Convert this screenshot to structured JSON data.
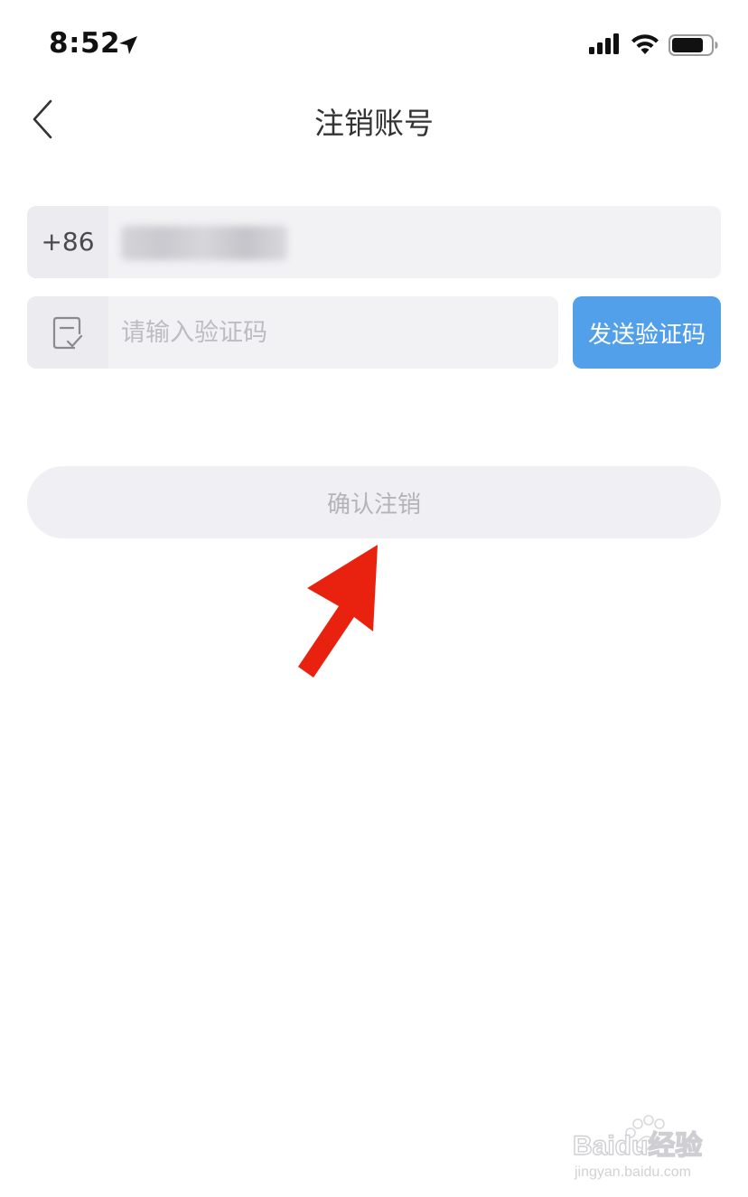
{
  "status_bar": {
    "time": "8:52",
    "icons": [
      "location-icon",
      "signal-icon",
      "wifi-icon",
      "battery-icon"
    ]
  },
  "nav": {
    "title": "注销账号",
    "back_icon": "chevron-left-icon"
  },
  "form": {
    "country_code": "+86",
    "phone_value": "",
    "code_placeholder": "请输入验证码",
    "code_icon": "verify-check-icon",
    "send_code_label": "发送验证码",
    "confirm_label": "确认注销"
  },
  "watermark": {
    "brand": "Baidu经验",
    "url": "jingyan.baidu.com"
  },
  "colors": {
    "accent": "#52a0ea",
    "field_bg": "#f2f2f5",
    "disabled_text": "#b3b3b9",
    "annotation": "#e8220f"
  }
}
